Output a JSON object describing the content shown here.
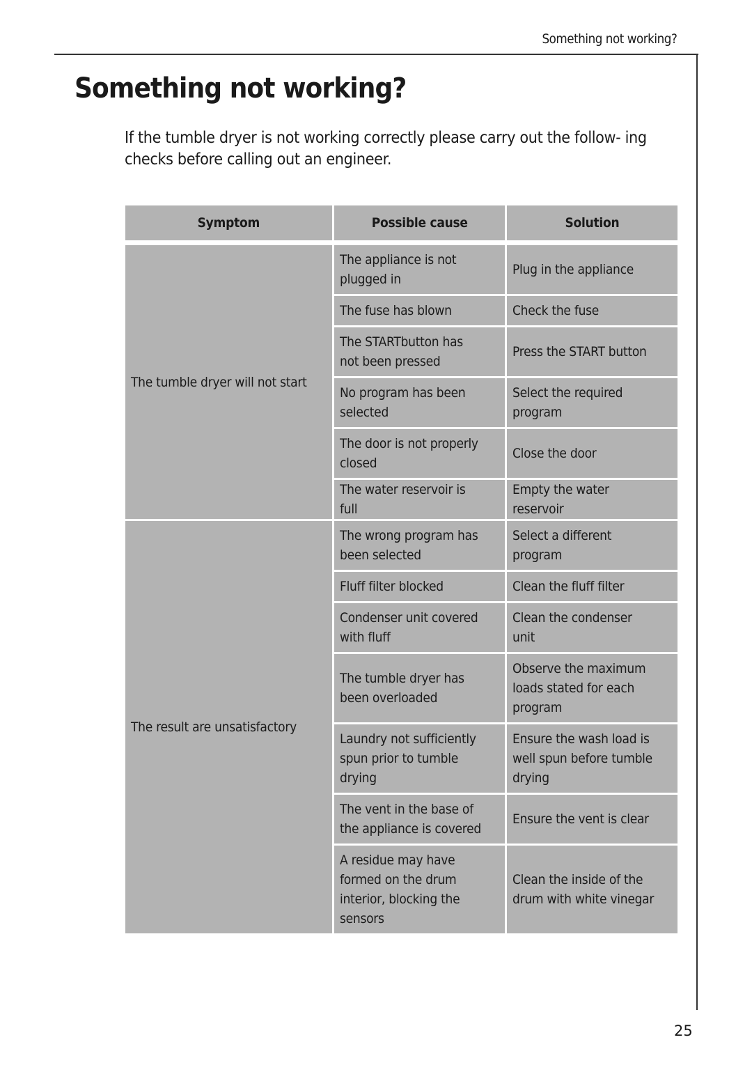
{
  "header": {
    "running_title": "Something not working?"
  },
  "page": {
    "title": "Something not working?",
    "intro": "If the tumble dryer is not working correctly please carry out the follow- ing checks before calling out an engineer.",
    "page_number": "25"
  },
  "table": {
    "columns": [
      "Symptom",
      "Possible cause",
      "Solution"
    ],
    "groups": [
      {
        "symptom": "The tumble dryer will not start",
        "rows": [
          {
            "cause": "The appliance is not plugged in",
            "solution": "Plug in the appliance"
          },
          {
            "cause": "The fuse has blown",
            "solution": "Check the fuse"
          },
          {
            "cause": "The STARTbutton has not been pressed",
            "solution": "Press the START button"
          },
          {
            "cause": "No program has been selected",
            "solution": "Select the required program"
          },
          {
            "cause": "The door is not properly closed",
            "solution": "Close the door"
          },
          {
            "cause": "The water reservoir is full",
            "solution": "Empty the water reservoir"
          }
        ]
      },
      {
        "symptom": "The result are unsatisfactory",
        "rows": [
          {
            "cause": "The wrong program has been selected",
            "solution": "Select a different program"
          },
          {
            "cause": "Fluff filter blocked",
            "solution": "Clean the fluff filter"
          },
          {
            "cause": "Condenser unit covered with fluff",
            "solution": "Clean the condenser unit"
          },
          {
            "cause": "The tumble dryer has been overloaded",
            "solution": "Observe the maximum loads stated for each program"
          },
          {
            "cause": "Laundry not sufficiently spun prior to tumble drying",
            "solution": "Ensure the wash load is well spun before tumble drying"
          },
          {
            "cause": "The vent in the base of the appliance is covered",
            "solution": "Ensure the vent is clear"
          },
          {
            "cause": "A residue may have formed on the drum interior, blocking the sensors",
            "solution": "Clean the inside of the drum with white vinegar"
          }
        ]
      }
    ]
  }
}
